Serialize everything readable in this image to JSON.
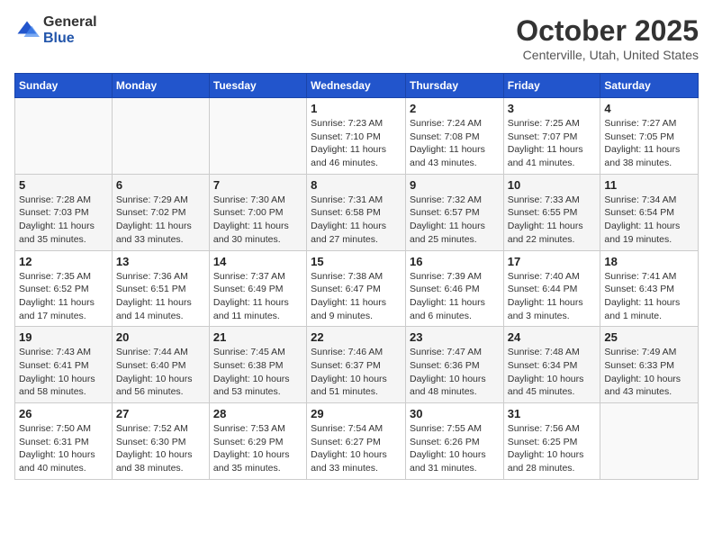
{
  "logo": {
    "general": "General",
    "blue": "Blue"
  },
  "title": "October 2025",
  "subtitle": "Centerville, Utah, United States",
  "days_header": [
    "Sunday",
    "Monday",
    "Tuesday",
    "Wednesday",
    "Thursday",
    "Friday",
    "Saturday"
  ],
  "weeks": [
    [
      {
        "day": "",
        "info": ""
      },
      {
        "day": "",
        "info": ""
      },
      {
        "day": "",
        "info": ""
      },
      {
        "day": "1",
        "info": "Sunrise: 7:23 AM\nSunset: 7:10 PM\nDaylight: 11 hours and 46 minutes."
      },
      {
        "day": "2",
        "info": "Sunrise: 7:24 AM\nSunset: 7:08 PM\nDaylight: 11 hours and 43 minutes."
      },
      {
        "day": "3",
        "info": "Sunrise: 7:25 AM\nSunset: 7:07 PM\nDaylight: 11 hours and 41 minutes."
      },
      {
        "day": "4",
        "info": "Sunrise: 7:27 AM\nSunset: 7:05 PM\nDaylight: 11 hours and 38 minutes."
      }
    ],
    [
      {
        "day": "5",
        "info": "Sunrise: 7:28 AM\nSunset: 7:03 PM\nDaylight: 11 hours and 35 minutes."
      },
      {
        "day": "6",
        "info": "Sunrise: 7:29 AM\nSunset: 7:02 PM\nDaylight: 11 hours and 33 minutes."
      },
      {
        "day": "7",
        "info": "Sunrise: 7:30 AM\nSunset: 7:00 PM\nDaylight: 11 hours and 30 minutes."
      },
      {
        "day": "8",
        "info": "Sunrise: 7:31 AM\nSunset: 6:58 PM\nDaylight: 11 hours and 27 minutes."
      },
      {
        "day": "9",
        "info": "Sunrise: 7:32 AM\nSunset: 6:57 PM\nDaylight: 11 hours and 25 minutes."
      },
      {
        "day": "10",
        "info": "Sunrise: 7:33 AM\nSunset: 6:55 PM\nDaylight: 11 hours and 22 minutes."
      },
      {
        "day": "11",
        "info": "Sunrise: 7:34 AM\nSunset: 6:54 PM\nDaylight: 11 hours and 19 minutes."
      }
    ],
    [
      {
        "day": "12",
        "info": "Sunrise: 7:35 AM\nSunset: 6:52 PM\nDaylight: 11 hours and 17 minutes."
      },
      {
        "day": "13",
        "info": "Sunrise: 7:36 AM\nSunset: 6:51 PM\nDaylight: 11 hours and 14 minutes."
      },
      {
        "day": "14",
        "info": "Sunrise: 7:37 AM\nSunset: 6:49 PM\nDaylight: 11 hours and 11 minutes."
      },
      {
        "day": "15",
        "info": "Sunrise: 7:38 AM\nSunset: 6:47 PM\nDaylight: 11 hours and 9 minutes."
      },
      {
        "day": "16",
        "info": "Sunrise: 7:39 AM\nSunset: 6:46 PM\nDaylight: 11 hours and 6 minutes."
      },
      {
        "day": "17",
        "info": "Sunrise: 7:40 AM\nSunset: 6:44 PM\nDaylight: 11 hours and 3 minutes."
      },
      {
        "day": "18",
        "info": "Sunrise: 7:41 AM\nSunset: 6:43 PM\nDaylight: 11 hours and 1 minute."
      }
    ],
    [
      {
        "day": "19",
        "info": "Sunrise: 7:43 AM\nSunset: 6:41 PM\nDaylight: 10 hours and 58 minutes."
      },
      {
        "day": "20",
        "info": "Sunrise: 7:44 AM\nSunset: 6:40 PM\nDaylight: 10 hours and 56 minutes."
      },
      {
        "day": "21",
        "info": "Sunrise: 7:45 AM\nSunset: 6:38 PM\nDaylight: 10 hours and 53 minutes."
      },
      {
        "day": "22",
        "info": "Sunrise: 7:46 AM\nSunset: 6:37 PM\nDaylight: 10 hours and 51 minutes."
      },
      {
        "day": "23",
        "info": "Sunrise: 7:47 AM\nSunset: 6:36 PM\nDaylight: 10 hours and 48 minutes."
      },
      {
        "day": "24",
        "info": "Sunrise: 7:48 AM\nSunset: 6:34 PM\nDaylight: 10 hours and 45 minutes."
      },
      {
        "day": "25",
        "info": "Sunrise: 7:49 AM\nSunset: 6:33 PM\nDaylight: 10 hours and 43 minutes."
      }
    ],
    [
      {
        "day": "26",
        "info": "Sunrise: 7:50 AM\nSunset: 6:31 PM\nDaylight: 10 hours and 40 minutes."
      },
      {
        "day": "27",
        "info": "Sunrise: 7:52 AM\nSunset: 6:30 PM\nDaylight: 10 hours and 38 minutes."
      },
      {
        "day": "28",
        "info": "Sunrise: 7:53 AM\nSunset: 6:29 PM\nDaylight: 10 hours and 35 minutes."
      },
      {
        "day": "29",
        "info": "Sunrise: 7:54 AM\nSunset: 6:27 PM\nDaylight: 10 hours and 33 minutes."
      },
      {
        "day": "30",
        "info": "Sunrise: 7:55 AM\nSunset: 6:26 PM\nDaylight: 10 hours and 31 minutes."
      },
      {
        "day": "31",
        "info": "Sunrise: 7:56 AM\nSunset: 6:25 PM\nDaylight: 10 hours and 28 minutes."
      },
      {
        "day": "",
        "info": ""
      }
    ]
  ]
}
